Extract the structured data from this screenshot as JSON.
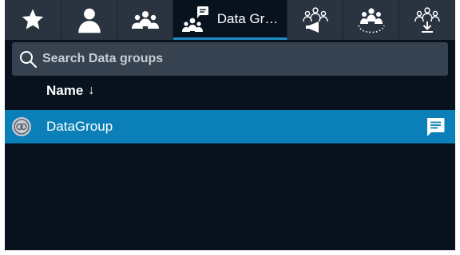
{
  "tabs": [
    {
      "icon": "star-icon",
      "label": ""
    },
    {
      "icon": "person-icon",
      "label": ""
    },
    {
      "icon": "people-group-icon",
      "label": ""
    },
    {
      "icon": "data-group-icon",
      "label": "Data Gr…",
      "active": true
    },
    {
      "icon": "group-announce-icon",
      "label": ""
    },
    {
      "icon": "group-circle-icon",
      "label": ""
    },
    {
      "icon": "group-download-icon",
      "label": ""
    }
  ],
  "search": {
    "placeholder": "Search Data groups",
    "value": ""
  },
  "list": {
    "column_header": "Name",
    "sort_indicator": "↓",
    "items": [
      {
        "name": "DataGroup",
        "selected": true,
        "icon": "data-group-avatar-icon",
        "action_icon": "comment-icon"
      }
    ]
  },
  "colors": {
    "background": "#08121f",
    "tabbar": "#2a3440",
    "search_bg": "#364250",
    "selection": "#0b7fb8",
    "active_underline": "#1e8cc4"
  }
}
